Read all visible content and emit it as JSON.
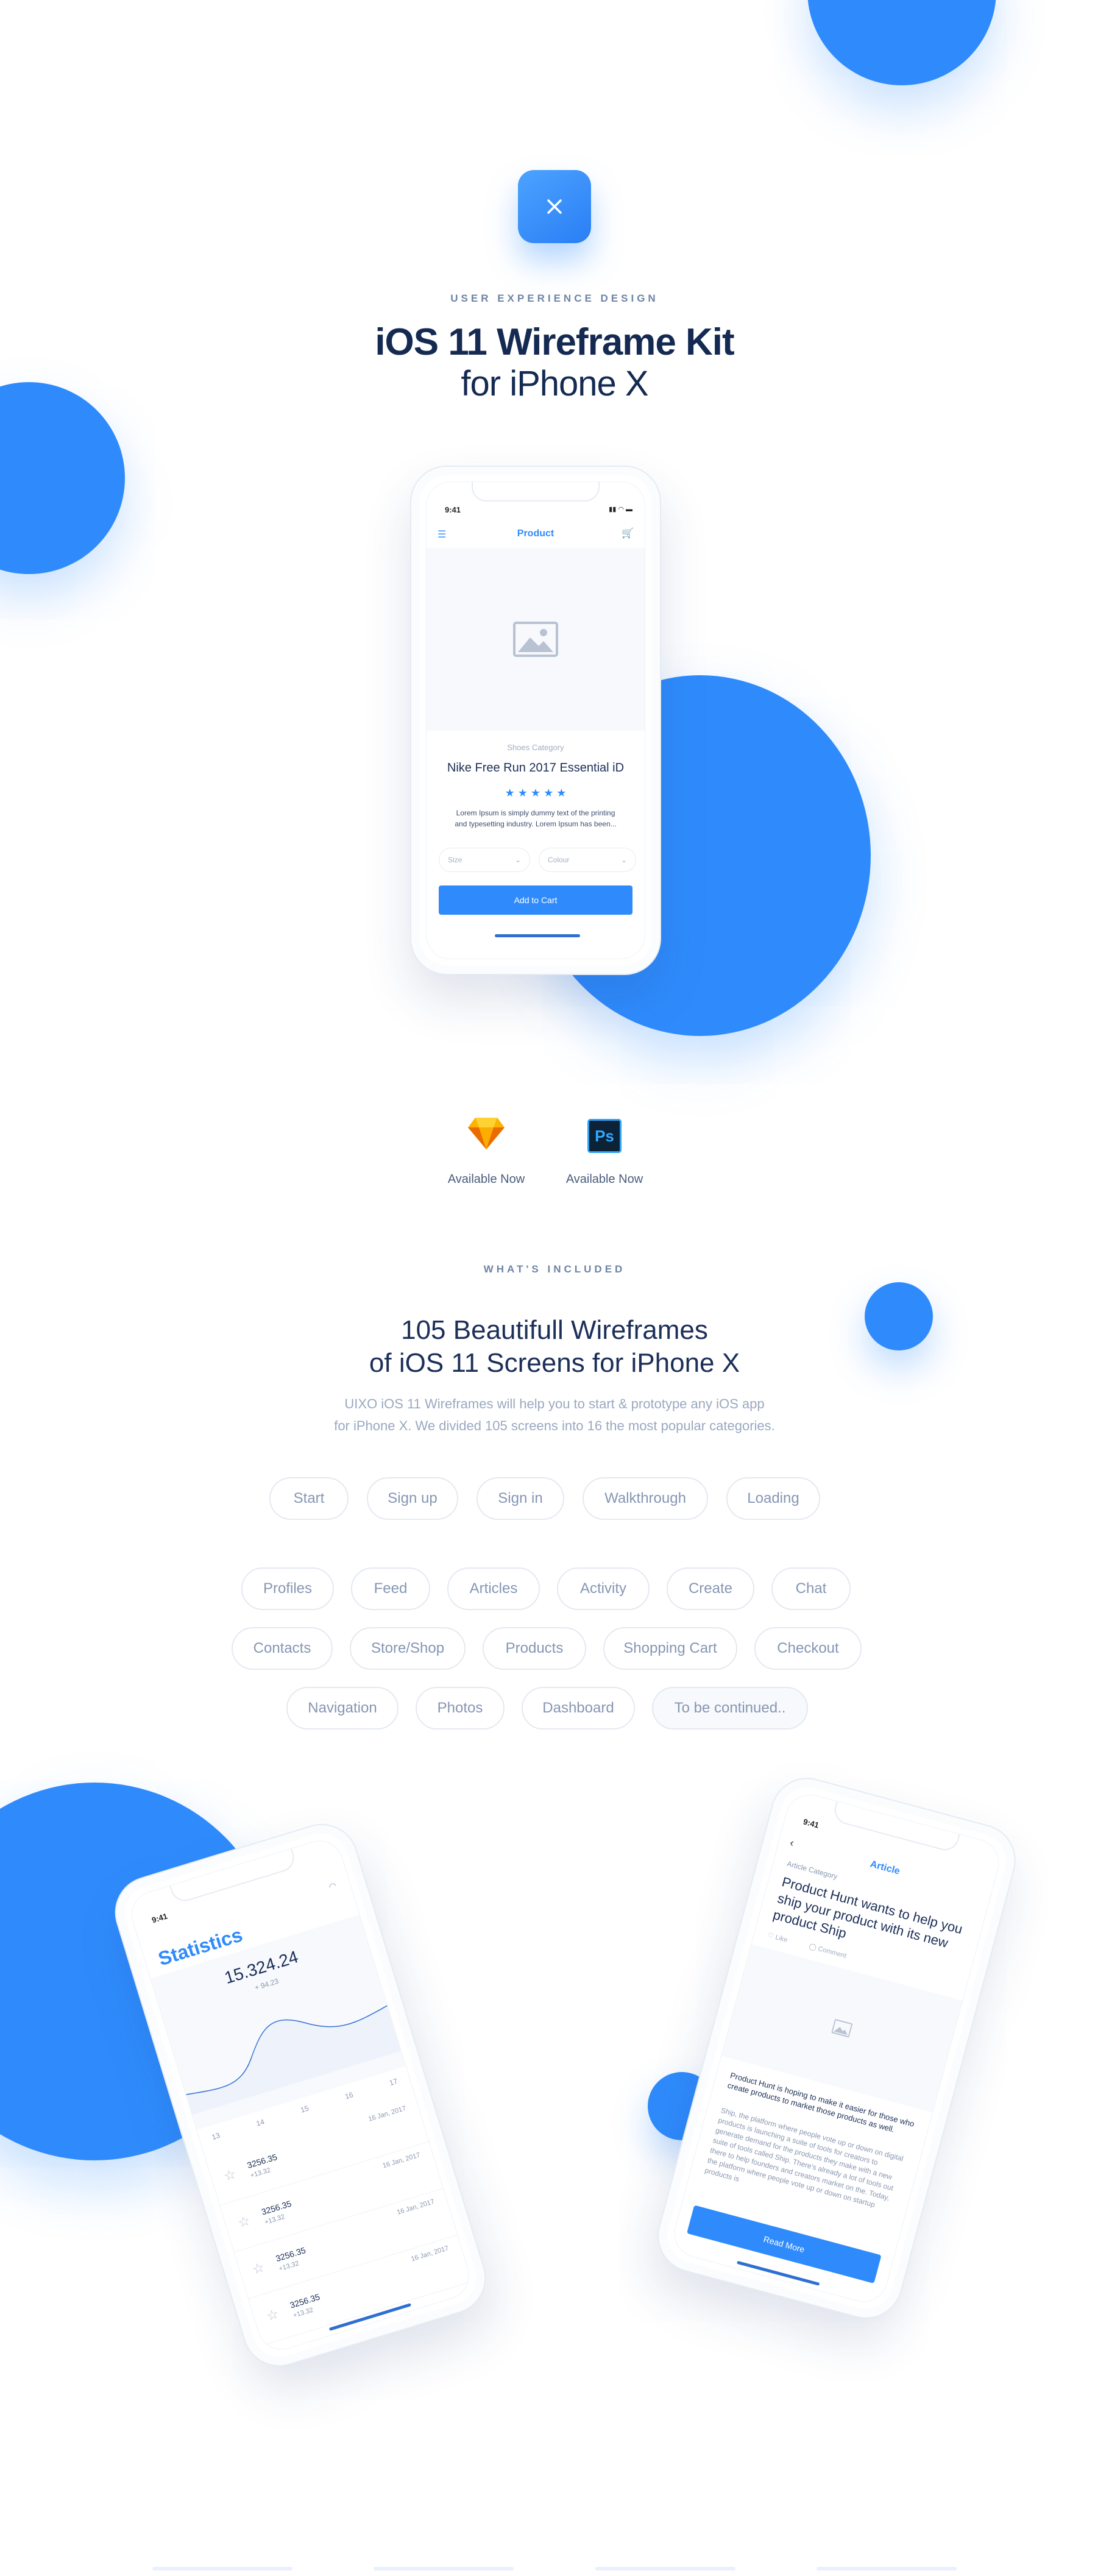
{
  "hero": {
    "eyebrow": "USER EXPERIENCE DESIGN",
    "title": "iOS 11 Wireframe Kit",
    "subtitle": "for iPhone X"
  },
  "product_phone": {
    "time": "9:41",
    "title": "Product",
    "category": "Shoes Category",
    "name": "Nike Free Run 2017 Essential iD",
    "rating": 5,
    "stars": "★ ★ ★ ★ ★",
    "description_line1": "Lorem Ipsum is simply dummy text of the printing",
    "description_line2": "and typesetting industry. Lorem Ipsum has been...",
    "size_label": "Size",
    "colour_label": "Colour",
    "cta": "Add to Cart"
  },
  "apps": [
    {
      "name": "sketch-icon",
      "label": "Available Now"
    },
    {
      "name": "photoshop-icon",
      "glyph": "Ps",
      "label": "Available Now"
    }
  ],
  "included": {
    "eyebrow": "WHAT'S INCLUDED",
    "title_line1": "105 Beautifull Wireframes",
    "title_line2": "of iOS 11 Screens for iPhone X",
    "desc_line1": "UIXO iOS 11 Wireframes will help you to start & prototype any iOS app",
    "desc_line2": "for iPhone X. We divided 105 screens into 16 the most popular categories."
  },
  "categories": [
    [
      "Start",
      "Sign up",
      "Sign in",
      "Walkthrough",
      "Loading"
    ],
    [
      "Profiles",
      "Feed",
      "Articles",
      "Activity",
      "Create",
      "Chat"
    ],
    [
      "Contacts",
      "Store/Shop",
      "Products",
      "Shopping Cart",
      "Checkout"
    ],
    [
      "Navigation",
      "Photos",
      "Dashboard",
      "To be continued.."
    ]
  ],
  "stats_phone": {
    "time": "9:41",
    "title": "Statistics",
    "total": "15.324.24",
    "delta": "+ 94.23",
    "x_labels": [
      "13",
      "14",
      "15",
      "16",
      "17"
    ],
    "rows": [
      {
        "value": "3256.35",
        "change": "+13.32",
        "date": "16 Jan, 2017"
      },
      {
        "value": "3256.35",
        "change": "+13.32",
        "date": "16 Jan, 2017"
      },
      {
        "value": "3256.35",
        "change": "+13.32",
        "date": "16 Jan, 2017"
      },
      {
        "value": "3256.35",
        "change": "+13.32",
        "date": "16 Jan, 2017"
      },
      {
        "value": "3256.35",
        "change": "",
        "date": ""
      }
    ]
  },
  "article_phone": {
    "time": "9:41",
    "title": "Article",
    "category": "Article Category",
    "headline": "Product Hunt wants to help you ship your product with its new product Ship",
    "like": "Like",
    "comment": "Comment",
    "lead": "Product Hunt is hoping to make it easier for those who create products to market those products as well.",
    "body": "Ship, the platform where people vote up or down on digital products is launching a suite of tools for creators to generate demand for the products they make with a new suite of tools called Ship. There's already a lot of tools out there to help founders and creators market on the. Today, the platform where people vote up or down on startup products is",
    "cta": "Read More"
  },
  "colors": {
    "accent": "#2f8bfc",
    "heading": "#152a52",
    "muted": "#8696b3"
  }
}
